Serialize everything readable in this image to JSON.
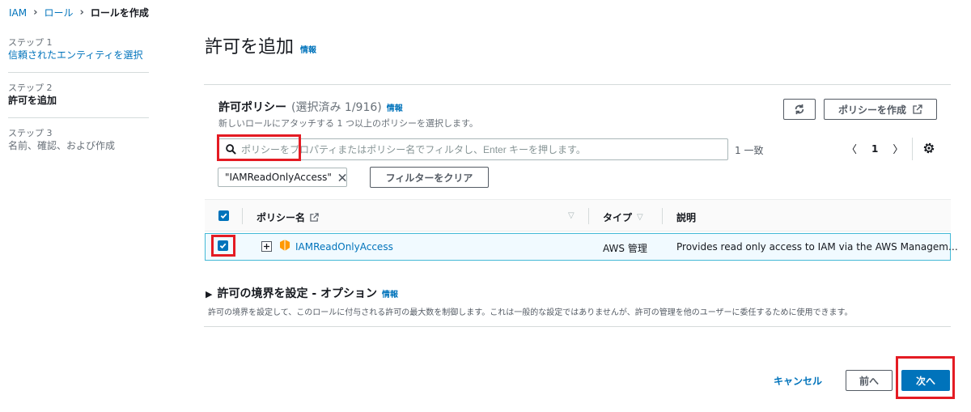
{
  "breadcrumb": [
    "IAM",
    "ロール",
    "ロールを作成"
  ],
  "steps": [
    {
      "num": "ステップ 1",
      "label": "信頼されたエンティティを選択"
    },
    {
      "num": "ステップ 2",
      "label": "許可を追加"
    },
    {
      "num": "ステップ 3",
      "label": "名前、確認、および作成"
    }
  ],
  "page": {
    "title": "許可を追加",
    "info": "情報"
  },
  "policies": {
    "title": "許可ポリシー",
    "count": "(選択済み 1/916)",
    "info": "情報",
    "description": "新しいロールにアタッチする 1 つ以上のポリシーを選択します。",
    "create_label": "ポリシーを作成",
    "search_placeholder": "ポリシーをプロパティまたはポリシー名でフィルタし、Enter キーを押します。",
    "match_count": "1 一致",
    "page": "1",
    "filter_token": "\"IAMReadOnlyAccess\"",
    "clear_filters": "フィルターをクリア",
    "columns": {
      "name": "ポリシー名",
      "type": "タイプ",
      "description": "説明"
    },
    "rows": [
      {
        "name": "IAMReadOnlyAccess",
        "type": "AWS 管理",
        "description": "Provides read only access to IAM via the AWS Managem…",
        "selected": true
      }
    ]
  },
  "boundary": {
    "title": "許可の境界を設定 - オプション",
    "info": "情報",
    "description": "許可の境界を設定して、このロールに付与される許可の最大数を制御します。これは一般的な設定ではありませんが、許可の管理を他のユーザーに委任するために使用できます。"
  },
  "footer": {
    "cancel": "キャンセル",
    "previous": "前へ",
    "next": "次へ"
  },
  "colors": {
    "accent": "#0073bb",
    "highlight": "#e41b23",
    "selected_row": "#f1faff",
    "aws_orange": "#f90"
  },
  "icons": [
    "search-icon",
    "refresh-icon",
    "external-link-icon",
    "gear-icon",
    "close-icon",
    "expand-icon",
    "policy-box-icon",
    "caret-right-icon"
  ]
}
